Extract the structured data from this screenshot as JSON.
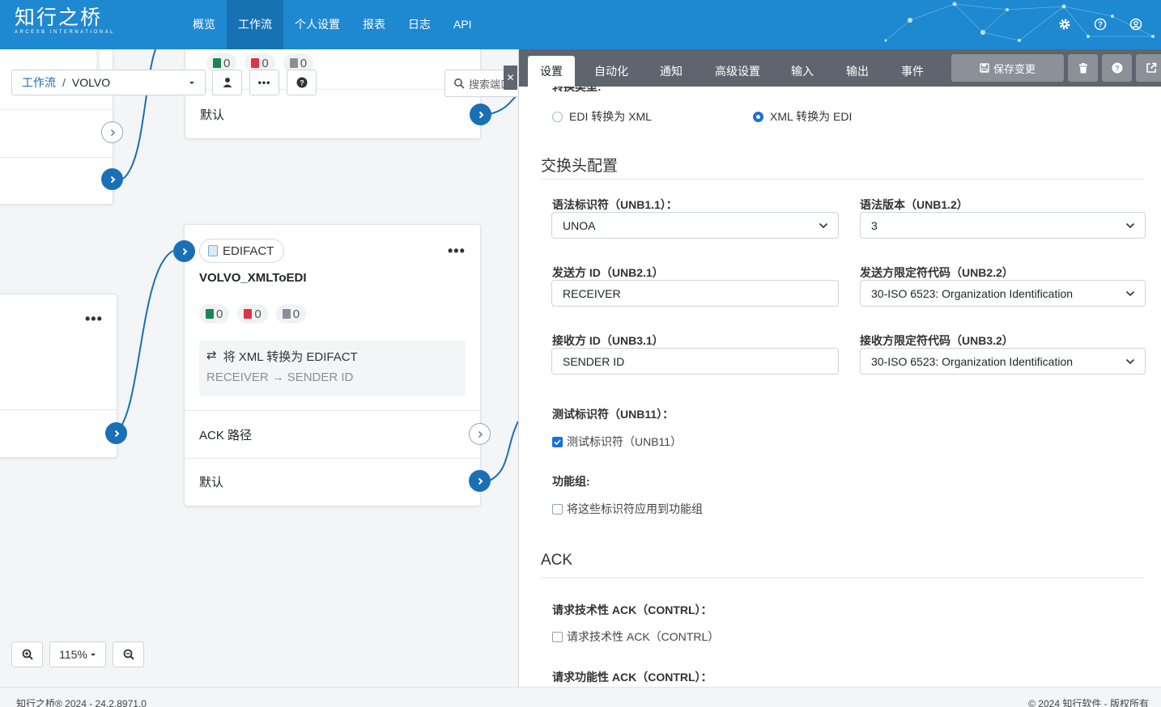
{
  "brand": {
    "name_cn": "知行之桥",
    "name_en": "ARCESB INTERNATIONAL"
  },
  "nav": {
    "items": [
      "概览",
      "工作流",
      "个人设置",
      "报表",
      "日志",
      "API"
    ],
    "active": "工作流"
  },
  "top_icons": [
    "gear-icon",
    "help-icon",
    "user-icon"
  ],
  "breadcrumb": {
    "root": "工作流",
    "separator": "/",
    "current": "VOLVO"
  },
  "search": {
    "placeholder": "搜索端口、"
  },
  "cards": {
    "top": {
      "stats": [
        "0",
        "0",
        "0"
      ],
      "default_label": "默认"
    },
    "main": {
      "type": "EDIFACT",
      "name": "VOLVO_XMLToEDI",
      "stats": [
        "0",
        "0",
        "0"
      ],
      "desc_line1": "将 XML 转换为 EDIFACT",
      "desc_from": "RECEIVER",
      "desc_to": "SENDER ID",
      "ack_label": "ACK 路径",
      "default_label": "默认"
    }
  },
  "zoom": {
    "level": "115%"
  },
  "panel": {
    "tabs": [
      "设置",
      "自动化",
      "通知",
      "高级设置",
      "输入",
      "输出",
      "事件"
    ],
    "active_tab": "设置",
    "save_label": "保存变更",
    "cut_label": "转换类型:",
    "radio_options": [
      "EDI 转换为 XML",
      "XML 转换为 EDI"
    ],
    "radio_selected": "XML 转换为 EDI",
    "section_header": "交换头配置",
    "fields": {
      "unb11_label": "语法标识符（UNB1.1）：",
      "unb11_value": "UNOA",
      "unb12_label": "语法版本（UNB1.2）",
      "unb12_value": "3",
      "unb21_label": "发送方 ID（UNB2.1）",
      "unb21_value": "RECEIVER",
      "unb22_label": "发送方限定符代码（UNB2.2）",
      "unb22_value": "30-ISO 6523: Organization Identification",
      "unb31_label": "接收方 ID（UNB3.1）",
      "unb31_value": "SENDER ID",
      "unb32_label": "接收方限定符代码（UNB3.2）",
      "unb32_value": "30-ISO 6523: Organization Identification"
    },
    "test_label": "测试标识符（UNB11）：",
    "test_check": "测试标识符（UNB11）",
    "test_checked": true,
    "group_label": "功能组:",
    "group_check": "将这些标识符应用到功能组",
    "ack_section": "ACK",
    "tech_ack_label": "请求技术性 ACK（CONTRL）：",
    "tech_ack_check": "请求技术性 ACK（CONTRL）",
    "func_ack_label": "请求功能性 ACK（CONTRL）："
  },
  "footer": {
    "left": "知行之桥® 2024 - 24.2.8971.0",
    "right": "© 2024 知行软件 - 版权所有"
  },
  "colors": {
    "nav_bg": "#1e88d0",
    "nav_active": "#1672b3",
    "connector": "#1a6fb5",
    "tab_bar": "#5e656e"
  }
}
